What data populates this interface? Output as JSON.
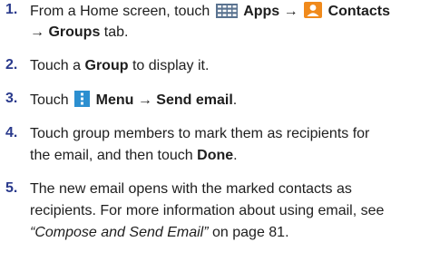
{
  "steps": [
    {
      "num": "1.",
      "l1": {
        "a": "From a Home screen, touch",
        "apps": "Apps",
        "contacts": "Contacts"
      },
      "l2": {
        "groups": "Groups",
        "tab": "tab."
      }
    },
    {
      "num": "2.",
      "pre": "Touch a",
      "group": "Group",
      "post": "to display it."
    },
    {
      "num": "3.",
      "pre": "Touch",
      "menu": "Menu",
      "send": "Send email",
      "period": "."
    },
    {
      "num": "4.",
      "l1": "Touch group members to mark them as recipients for",
      "l2pre": "the email, and then touch",
      "done": "Done",
      "period": "."
    },
    {
      "num": "5.",
      "l1": "The new email opens with the marked contacts as",
      "l2": "recipients. For more information about using email, see",
      "l3link": "“Compose and Send Email”",
      "l3post": "on page 81."
    }
  ],
  "arrow": "→",
  "icons": {
    "apps": "apps-grid-icon",
    "contacts": "contacts-person-icon",
    "menu": "menu-dots-icon"
  },
  "colors": {
    "number": "#2a3a8c",
    "apps_icon": "#5a7390",
    "contacts_icon": "#f08a1c",
    "menu_icon": "#2c8fd0"
  }
}
